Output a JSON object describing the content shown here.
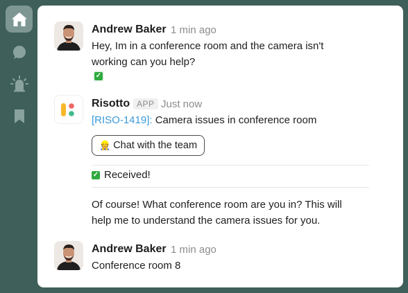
{
  "sidebar": {
    "items": [
      {
        "icon": "home-icon",
        "active": true
      },
      {
        "icon": "chat-bubble-icon",
        "active": false
      },
      {
        "icon": "alarm-icon",
        "active": false
      },
      {
        "icon": "bookmark-icon",
        "active": false
      }
    ]
  },
  "messages": [
    {
      "author": "Andrew Baker",
      "time": "1 min ago",
      "lines": [
        "Hey, Im in a conference room and the camera isn't",
        "working can you help?"
      ],
      "reaction": "✅"
    },
    {
      "author": "Risotto",
      "badge": "APP",
      "time": "Just now",
      "ticket_link": "[RISO-1419]:",
      "ticket_title": " Camera issues in conference room",
      "button_emoji": "👷",
      "button_label": "Chat with the team",
      "received_emoji": "✅",
      "received_text": "Received!",
      "reply_lines": [
        "Of course! What conference room are you in? This will",
        "help me to understand the camera issues for you."
      ]
    },
    {
      "author": "Andrew Baker",
      "time": "1 min ago",
      "text": "Conference room 8"
    }
  ],
  "colors": {
    "sidebar_bg": "#3e5f5a",
    "active_item": "#7e9793",
    "link": "#3a9ad9",
    "success": "#2eaa3e"
  }
}
